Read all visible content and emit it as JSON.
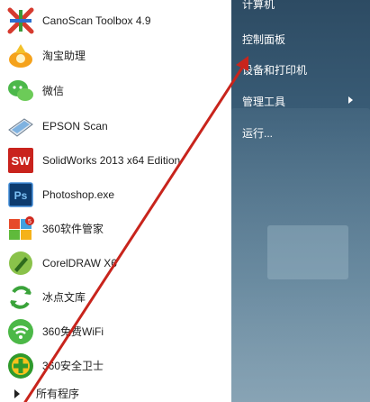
{
  "programs": [
    {
      "label": "CanoScan Toolbox 4.9",
      "icon": "canoscan-icon"
    },
    {
      "label": "淘宝助理",
      "icon": "taobao-helper-icon"
    },
    {
      "label": "微信",
      "icon": "wechat-icon"
    },
    {
      "label": "EPSON Scan",
      "icon": "epson-scan-icon"
    },
    {
      "label": "SolidWorks 2013 x64 Edition",
      "icon": "solidworks-icon"
    },
    {
      "label": "Photoshop.exe",
      "icon": "photoshop-icon"
    },
    {
      "label": "360软件管家",
      "icon": "360-software-manager-icon"
    },
    {
      "label": "CorelDRAW X6",
      "icon": "coreldraw-icon"
    },
    {
      "label": "冰点文库",
      "icon": "bingdian-wenku-icon"
    },
    {
      "label": "360免费WiFi",
      "icon": "360-wifi-icon"
    },
    {
      "label": "360安全卫士",
      "icon": "360-security-icon"
    }
  ],
  "all_programs": {
    "label": "所有程序"
  },
  "right_pane": {
    "top_partial": "计算机",
    "control_panel": "控制面板",
    "devices_printers": "设备和打印机",
    "admin_tools": "管理工具",
    "run": "运行..."
  },
  "colors": {
    "annotation_arrow": "#c8241c",
    "right_pane": "#3a5d77"
  }
}
